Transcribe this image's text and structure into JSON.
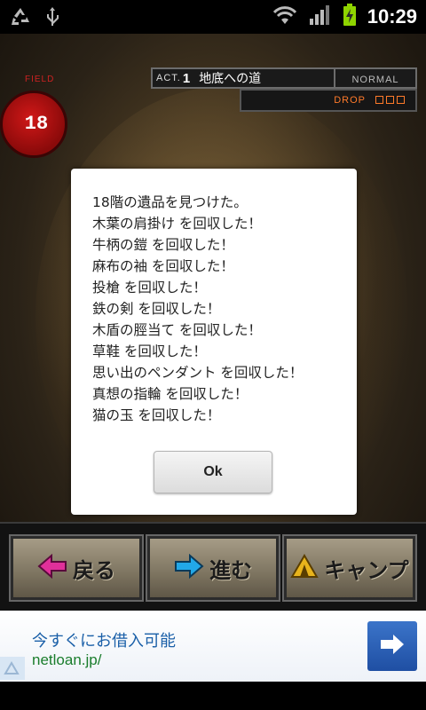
{
  "status_bar": {
    "time": "10:29",
    "icons": [
      "recycle-icon",
      "usb-icon",
      "wifi-icon",
      "signal-icon",
      "battery-charging-icon"
    ]
  },
  "hud": {
    "act_label": "ACT.",
    "act_number": "1",
    "act_title": "地底への道",
    "difficulty": "NORMAL",
    "drop_label": "DROP",
    "field_label": "FIELD",
    "floor_number": "18"
  },
  "dialog": {
    "lines": [
      "18階の遺品を見つけた。",
      "木葉の肩掛け を回収した！",
      "牛柄の鎧 を回収した！",
      "麻布の袖 を回収した！",
      "投槍 を回収した！",
      "鉄の剣 を回収した！",
      "木盾の脛当て を回収した！",
      "草鞋 を回収した！",
      "思い出のペンダント を回収した！",
      "真想の指輪 を回収した！",
      "猫の玉 を回収した！"
    ],
    "ok_label": "Ok"
  },
  "controls": {
    "back_label": "戻る",
    "forward_label": "進む",
    "camp_label": "キャンプ"
  },
  "ad": {
    "headline": "今すぐにお借入可能",
    "url": "netloan.jp/"
  },
  "colors": {
    "ad_headline": "#1a5fa8",
    "ad_url": "#1a7d2c",
    "drop_accent": "#ff7a2a",
    "floor_red": "#d01818"
  }
}
